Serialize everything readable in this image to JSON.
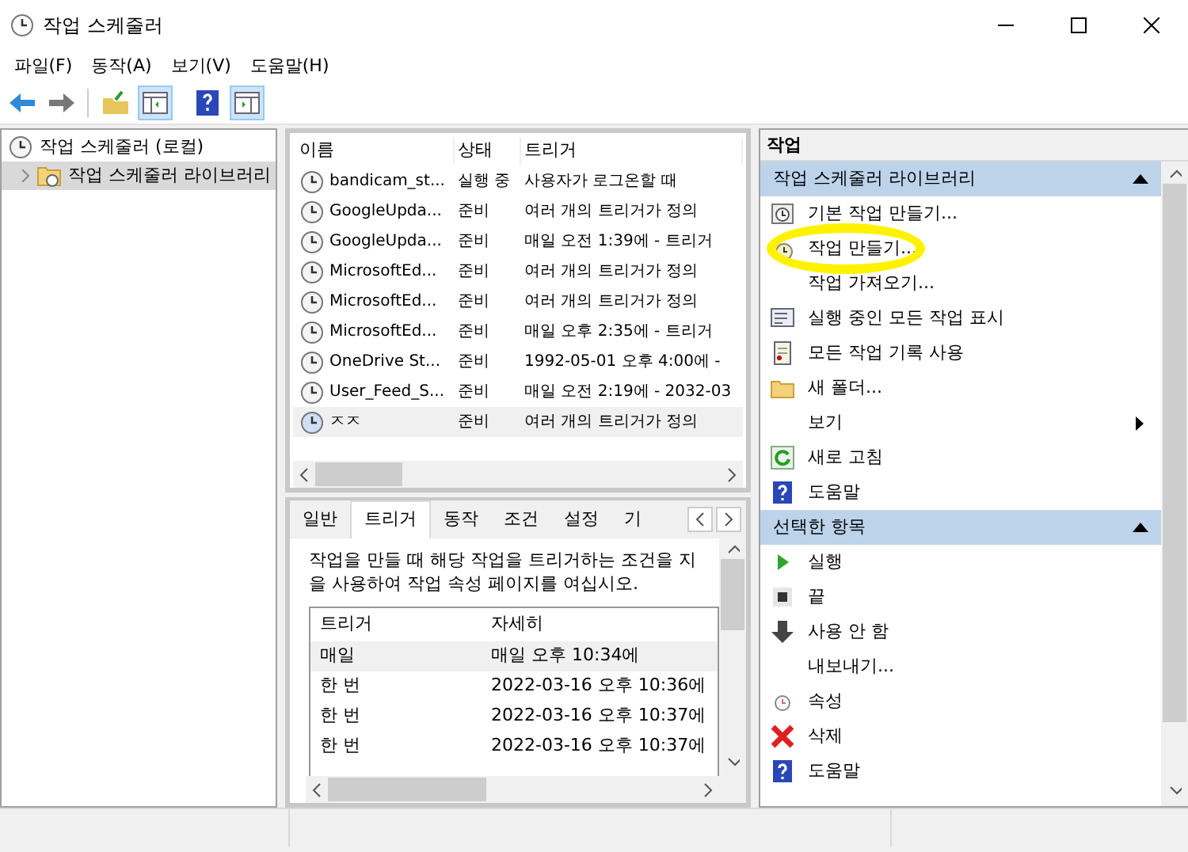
{
  "window": {
    "title": "작업 스케줄러"
  },
  "menu": [
    {
      "label": "파일(F)"
    },
    {
      "label": "동작(A)"
    },
    {
      "label": "보기(V)"
    },
    {
      "label": "도움말(H)"
    }
  ],
  "tree": [
    {
      "label": "작업 스케줄러 (로컬)",
      "selected": false,
      "children": [
        {
          "label": "작업 스케줄러 라이브러리",
          "selected": true,
          "expanded": false
        }
      ]
    }
  ],
  "task_list": {
    "columns": [
      "이름",
      "상태",
      "트리거"
    ],
    "rows": [
      {
        "name": "bandicam_st...",
        "status": "실행 중",
        "trigger": "사용자가 로그온할 때",
        "selected": false
      },
      {
        "name": "GoogleUpda...",
        "status": "준비",
        "trigger": "여러 개의 트리거가 정의",
        "selected": false
      },
      {
        "name": "GoogleUpda...",
        "status": "준비",
        "trigger": "매일 오전 1:39에 - 트리거",
        "selected": false
      },
      {
        "name": "MicrosoftEd...",
        "status": "준비",
        "trigger": "여러 개의 트리거가 정의",
        "selected": false
      },
      {
        "name": "MicrosoftEd...",
        "status": "준비",
        "trigger": "여러 개의 트리거가 정의",
        "selected": false
      },
      {
        "name": "MicrosoftEd...",
        "status": "준비",
        "trigger": "매일 오후 2:35에 - 트리거",
        "selected": false
      },
      {
        "name": "OneDrive St...",
        "status": "준비",
        "trigger": "1992-05-01 오후 4:00에 -",
        "selected": false
      },
      {
        "name": "User_Feed_S...",
        "status": "준비",
        "trigger": "매일 오전 2:19에 - 2032-03",
        "selected": false
      },
      {
        "name": "ㅈㅈ",
        "status": "준비",
        "trigger": "여러 개의 트리거가 정의",
        "selected": true
      }
    ]
  },
  "detail": {
    "tabs": [
      {
        "label": "일반",
        "selected": false
      },
      {
        "label": "트리거",
        "selected": true
      },
      {
        "label": "동작",
        "selected": false
      },
      {
        "label": "조건",
        "selected": false
      },
      {
        "label": "설정",
        "selected": false
      },
      {
        "label": "기",
        "selected": false
      }
    ],
    "description": "작업을 만들 때 해당 작업을 트리거하는 조건을 지\n을 사용하여 작업 속성 페이지를 여십시오.",
    "columns": [
      "트리거",
      "자세히"
    ],
    "rows": [
      {
        "trigger": "매일",
        "details": "매일 오후 10:34에",
        "selected": true
      },
      {
        "trigger": "한 번",
        "details": "2022-03-16 오후 10:36에",
        "selected": false
      },
      {
        "trigger": "한 번",
        "details": "2022-03-16 오후 10:37에",
        "selected": false
      },
      {
        "trigger": "한 번",
        "details": "2022-03-16 오후 10:37에",
        "selected": false
      }
    ]
  },
  "actions": {
    "title": "작업",
    "sections": [
      {
        "title": "작업 스케줄러 라이브러리",
        "expanded": true,
        "items": [
          {
            "label": "기본 작업 만들기...",
            "kind": "basic"
          },
          {
            "label": "작업 만들기...",
            "kind": "create",
            "highlighted": true
          },
          {
            "label": "작업 가져오기...",
            "kind": "none"
          },
          {
            "label": "실행 중인 모든 작업 표시",
            "kind": "running"
          },
          {
            "label": "모든 작업 기록 사용",
            "kind": "history"
          },
          {
            "label": "새 폴더...",
            "kind": "folder"
          },
          {
            "label": "보기",
            "kind": "submenu"
          },
          {
            "label": "새로 고침",
            "kind": "refresh"
          },
          {
            "label": "도움말",
            "kind": "help"
          }
        ]
      },
      {
        "title": "선택한 항목",
        "expanded": true,
        "items": [
          {
            "label": "실행",
            "kind": "run"
          },
          {
            "label": "끝",
            "kind": "stop"
          },
          {
            "label": "사용 안 함",
            "kind": "disable"
          },
          {
            "label": "내보내기...",
            "kind": "none"
          },
          {
            "label": "속성",
            "kind": "properties"
          },
          {
            "label": "삭제",
            "kind": "delete"
          },
          {
            "label": "도움말",
            "kind": "help"
          }
        ]
      }
    ]
  }
}
